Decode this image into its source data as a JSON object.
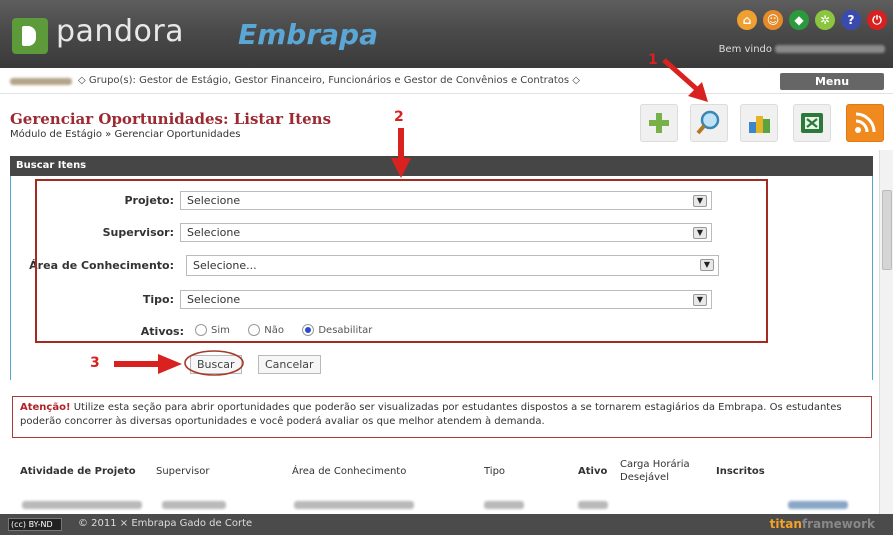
{
  "header": {
    "app_name": "pandora",
    "brand": "Embrapa",
    "welcome": "Bem vindo"
  },
  "groups": {
    "text": "◇ Grupo(s): Gestor de Estágio, Gestor Financeiro, Funcionários e Gestor de Convênios e Contratos ◇"
  },
  "menu_label": "Menu",
  "page": {
    "title": "Gerenciar Oportunidades: Listar Itens",
    "breadcrumb": "Módulo de Estágio » Gerenciar Oportunidades"
  },
  "annotations": {
    "n1": "1",
    "n2": "2",
    "n3": "3"
  },
  "search": {
    "section_title": "Buscar Itens",
    "fields": [
      {
        "label": "Projeto:",
        "value": "Selecione"
      },
      {
        "label": "Supervisor:",
        "value": "Selecione"
      },
      {
        "label": "Área de Conhecimento:",
        "value": "Selecione..."
      },
      {
        "label": "Tipo:",
        "value": "Selecione"
      }
    ],
    "ativos_label": "Ativos:",
    "radio_options": [
      "Sim",
      "Não",
      "Desabilitar"
    ],
    "radio_selected": "Desabilitar",
    "search_button": "Buscar",
    "cancel_button": "Cancelar"
  },
  "notice": {
    "strong": "Atenção!",
    "text": " Utilize esta seção para abrir oportunidades que poderão ser visualizadas por estudantes dispostos a se tornarem estagiários da Embrapa. Os estudantes poderão concorrer às diversas oportunidades e você poderá avaliar os que melhor atendem à demanda."
  },
  "table": {
    "headers": [
      "Atividade de Projeto",
      "Supervisor",
      "Área de Conhecimento",
      "Tipo",
      "Ativo",
      "Carga Horária Desejável",
      "Inscritos"
    ]
  },
  "footer": {
    "license": "(cc) BY-ND",
    "copyright": "© 2011 × Embrapa Gado de Corte",
    "framework_a": "titan",
    "framework_b": "framework"
  },
  "colors": {
    "header_bg": "#4a4a4a",
    "accent_red": "#9b2a32",
    "annotation_red": "#d9221f",
    "panel_border": "#4fa9c9",
    "brand_blue": "#5aa7d6"
  }
}
